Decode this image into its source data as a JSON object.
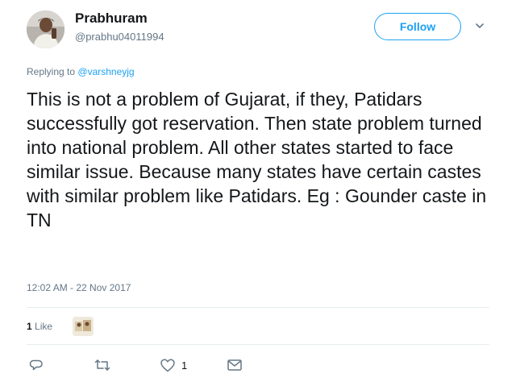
{
  "author": {
    "name": "Prabhuram",
    "handle": "@prabhu04011994"
  },
  "follow_button": {
    "label": "Follow"
  },
  "reply": {
    "prefix": "Replying to",
    "to": "@varshneyjg"
  },
  "tweet": {
    "text": "This is not a problem of Gujarat, if they, Patidars successfully got reservation. Then state problem turned into national problem. All other states started to face similar issue. Because many states have certain castes with similar problem like Patidars. Eg : Gounder caste in TN",
    "timestamp": "12:02 AM - 22 Nov 2017"
  },
  "stats": {
    "likes_count": "1",
    "likes_label": "Like"
  },
  "actions": {
    "reply_icon": "reply-icon",
    "retweet_icon": "retweet-icon",
    "like_icon": "heart-icon",
    "like_count": "1",
    "dm_icon": "envelope-icon"
  },
  "colors": {
    "accent": "#1da1f2",
    "muted": "#657786",
    "text": "#14171a",
    "divider": "#e6ecf0"
  }
}
